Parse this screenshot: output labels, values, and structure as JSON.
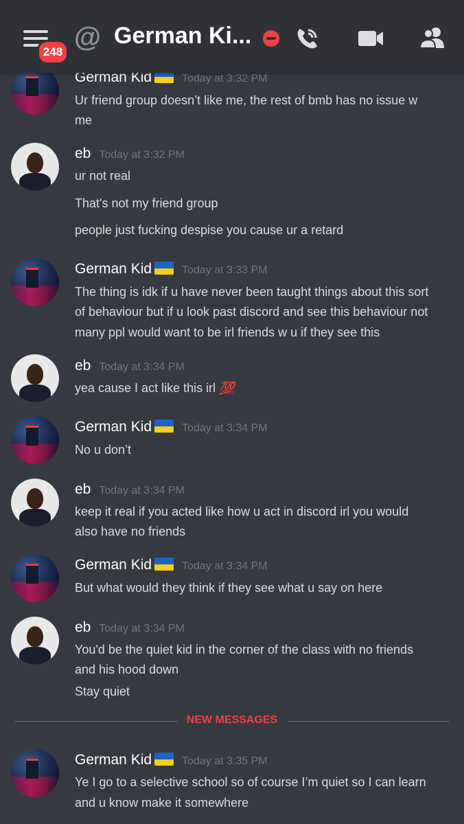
{
  "header": {
    "badge_count": "248",
    "at_symbol": "@",
    "channel_name": "German Ki...",
    "status": "do-not-disturb",
    "icons": [
      "menu-icon",
      "at-icon",
      "call-icon",
      "video-icon",
      "members-icon"
    ]
  },
  "colors": {
    "background": "#36393f",
    "header": "#2f3136",
    "accent_red": "#ed4245",
    "timestamp": "#72767d"
  },
  "messages": [
    {
      "author": "German Kid",
      "flag": "ukraine-flag",
      "time": "Today at 3:32 PM",
      "lines": [
        "Ur friend group doesn’t like me, the rest of bmb has no issue w",
        "me"
      ]
    },
    {
      "author": "eb",
      "time": "Today at 3:32 PM",
      "lines": [
        "ur not real",
        "That's not my friend group",
        "people just fucking despise you cause ur a  retard"
      ]
    },
    {
      "author": "German Kid",
      "flag": "ukraine-flag",
      "time": "Today at 3:33 PM",
      "lines": [
        "The thing is idk if u have never been taught things about this sort",
        "of behaviour but if u look past discord and see this behaviour not",
        "many ppl would want to be irl friends w u if they see this"
      ]
    },
    {
      "author": "eb",
      "time": "Today at 3:34 PM",
      "lines": [
        "yea cause I act like this irl"
      ],
      "emoji": "100-emoji",
      "emoji_text": "💯"
    },
    {
      "author": "German Kid",
      "flag": "ukraine-flag",
      "time": "Today at 3:34 PM",
      "lines": [
        "No u don’t"
      ]
    },
    {
      "author": "eb",
      "time": "Today at 3:34 PM",
      "lines": [
        "keep it real if you acted like how u act in discord irl you would",
        "also have no friends"
      ]
    },
    {
      "author": "German Kid",
      "flag": "ukraine-flag",
      "time": "Today at 3:34 PM",
      "lines": [
        "But what would they think if they see what u say on here"
      ]
    },
    {
      "author": "eb",
      "time": "Today at 3:34 PM",
      "lines": [
        "You'd be the quiet kid in the corner of the class with no friends",
        "and his hood down",
        "Stay quiet"
      ]
    },
    {
      "author": "German Kid",
      "flag": "ukraine-flag",
      "time": "Today at 3:35 PM",
      "lines": [
        "Ye I go to a selective school so of course I’m quiet so I can learn",
        "and u know make it somewhere"
      ]
    }
  ],
  "divider": {
    "label": "NEW MESSAGES"
  }
}
